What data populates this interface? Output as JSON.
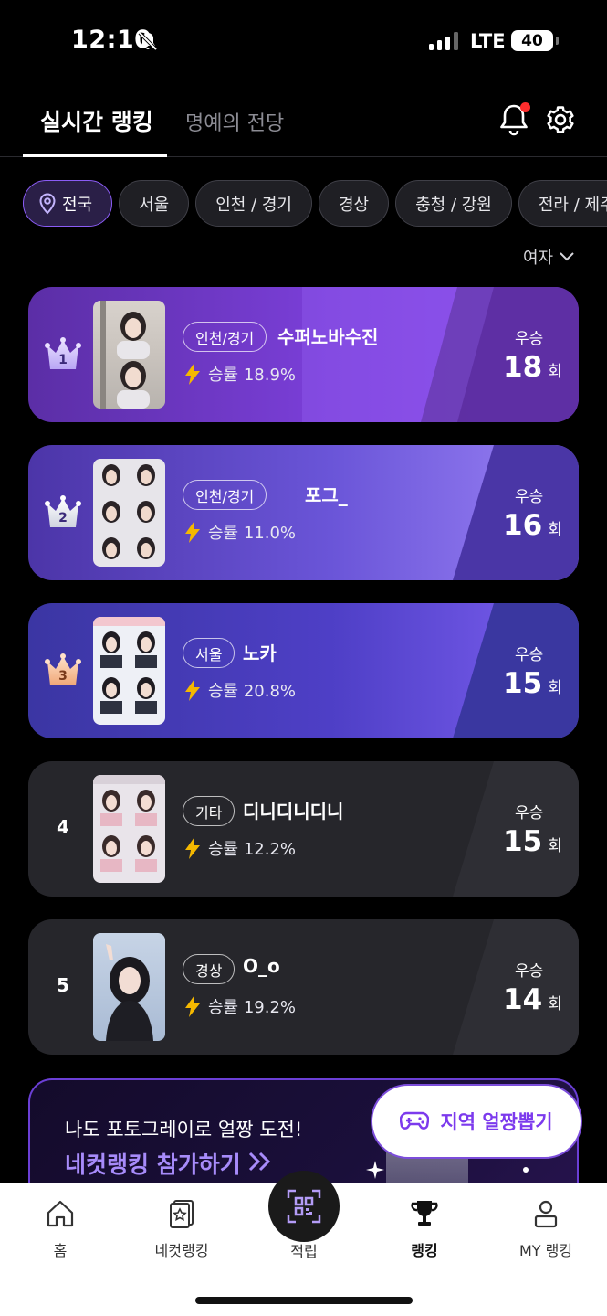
{
  "status_bar": {
    "time": "12:10",
    "network": "LTE",
    "battery": "40"
  },
  "header": {
    "tab_active": "실시간 랭킹",
    "tab_inactive": "명예의 전당"
  },
  "regions": [
    "전국",
    "서울",
    "인천 / 경기",
    "경상",
    "충청 / 강원",
    "전라 / 제주"
  ],
  "gender_filter": "여자",
  "rankings": [
    {
      "rank": "1",
      "region": "인천/경기",
      "name": "수퍼노바수진",
      "rate": "승률 18.9%",
      "win_label": "우승",
      "wins": "18",
      "unit": "회"
    },
    {
      "rank": "2",
      "region": "인천/경기",
      "name": "포그_",
      "rate": "승률 11.0%",
      "win_label": "우승",
      "wins": "16",
      "unit": "회"
    },
    {
      "rank": "3",
      "region": "서울",
      "name": "노카",
      "rate": "승률 20.8%",
      "win_label": "우승",
      "wins": "15",
      "unit": "회"
    },
    {
      "rank": "4",
      "region": "기타",
      "name": "디니디니디니",
      "rate": "승률 12.2%",
      "win_label": "우승",
      "wins": "15",
      "unit": "회"
    },
    {
      "rank": "5",
      "region": "경상",
      "name": "O_o",
      "rate": "승률 19.2%",
      "win_label": "우승",
      "wins": "14",
      "unit": "회"
    }
  ],
  "promo": {
    "subtitle": "나도 포토그레이로 얼짱 도전!",
    "cta": "네컷랭킹 참가하기"
  },
  "float_button": "지역 얼짱뽑기",
  "nav": {
    "home": "홈",
    "necut": "네컷랭킹",
    "points": "적립",
    "ranking": "랭킹",
    "my": "MY 랭킹"
  },
  "colors": {
    "accent": "#8b5cf6",
    "card_dark": "#26262b"
  }
}
